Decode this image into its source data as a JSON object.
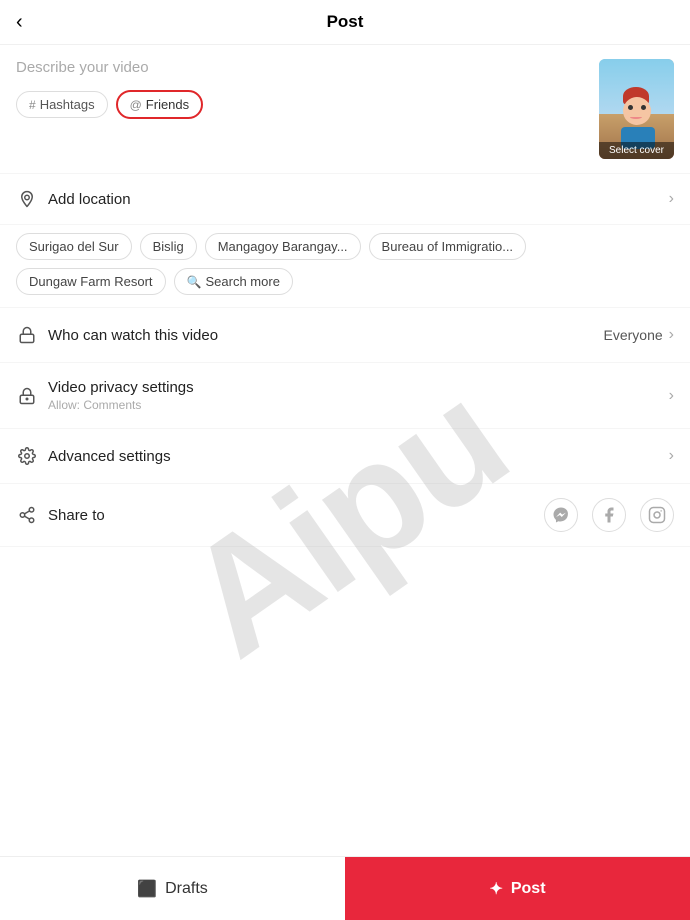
{
  "header": {
    "title": "Post",
    "back_icon": "‹"
  },
  "description": {
    "placeholder": "Describe your video",
    "hashtag_btn": "Hashtags",
    "friends_btn": "Friends",
    "hashtag_icon": "#",
    "friends_icon": "@"
  },
  "thumbnail": {
    "label": "Select cover"
  },
  "location": {
    "label": "Add location",
    "chips": [
      "Surigao del Sur",
      "Bislig",
      "Mangagoy Barangay...",
      "Bureau of Immigratio...",
      "Dungaw Farm Resort"
    ],
    "search_chip": "Search more"
  },
  "settings": [
    {
      "id": "who-can-watch",
      "title": "Who can watch this video",
      "value": "Everyone",
      "subtitle": ""
    },
    {
      "id": "video-privacy",
      "title": "Video privacy settings",
      "value": "",
      "subtitle": "Allow: Comments"
    },
    {
      "id": "advanced",
      "title": "Advanced settings",
      "value": "",
      "subtitle": ""
    }
  ],
  "share": {
    "label": "Share to",
    "platforms": [
      "messenger",
      "facebook",
      "instagram"
    ]
  },
  "watermark": {
    "text": "Aipu"
  },
  "bottom": {
    "drafts_label": "Drafts",
    "post_label": "Post"
  }
}
